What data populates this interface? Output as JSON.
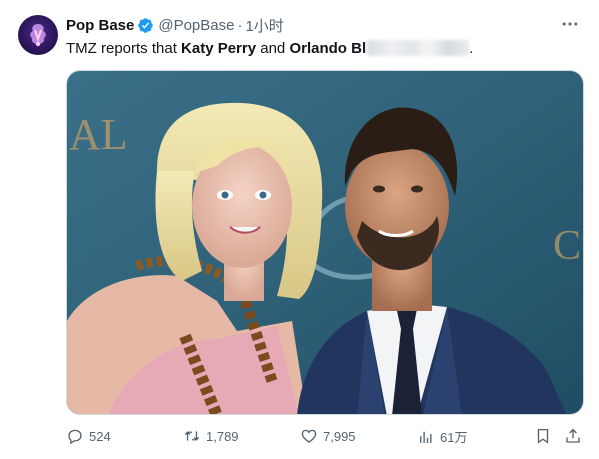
{
  "tweet": {
    "display_name": "Pop Base",
    "handle": "@PopBase",
    "separator": "·",
    "time": "1小时",
    "text_prefix": "TMZ reports that ",
    "name_one": "Katy Perry",
    "conjunction": " and ",
    "name_two": "Orlando Bl",
    "text_suffix": ".",
    "media_backdrop_letters_left": "AL",
    "media_backdrop_letters_right": "C"
  },
  "actions": {
    "replies": "524",
    "retweets": "1,789",
    "likes": "7,995",
    "views": "61万"
  },
  "icons": [
    "verified-badge-icon",
    "more-options-icon",
    "reply-icon",
    "retweet-icon",
    "like-icon",
    "views-icon",
    "bookmark-icon",
    "share-icon"
  ],
  "colors": {
    "verified": "#1d9bf0",
    "secondary_text": "#536471",
    "photo_background": "#2f6178"
  }
}
